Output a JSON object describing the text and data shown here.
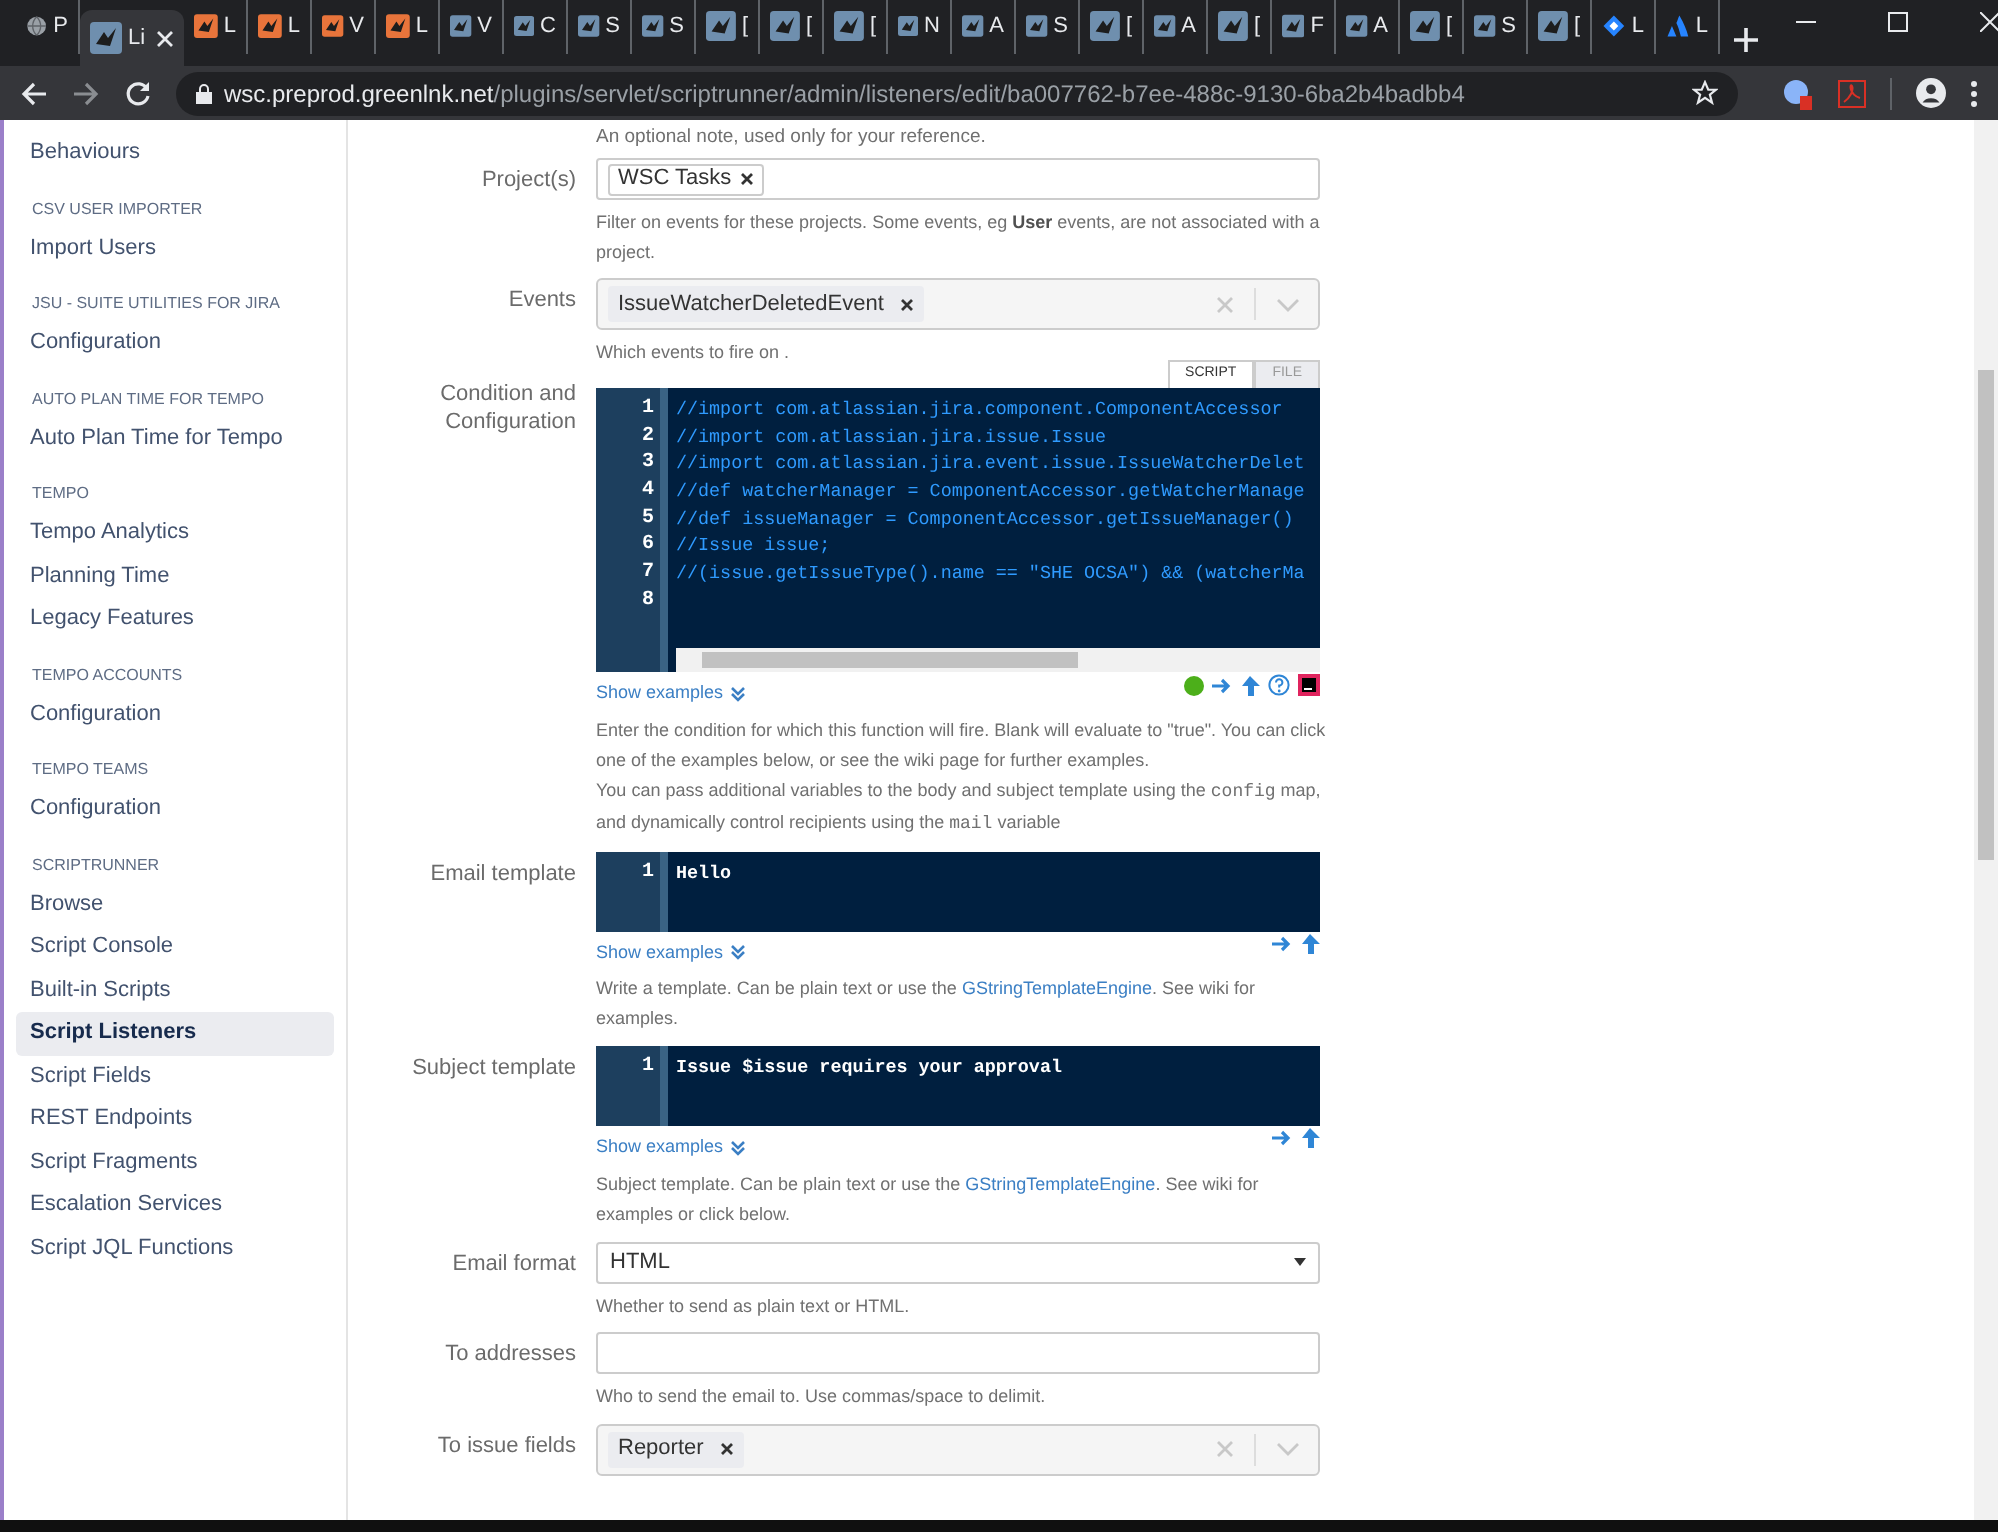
{
  "browser": {
    "tabs": [
      {
        "label": "P",
        "kind": "globe",
        "selected": false
      },
      {
        "label": "Li",
        "kind": "steel",
        "selected": true
      },
      {
        "label": "L",
        "kind": "orange",
        "selected": false
      },
      {
        "label": "L",
        "kind": "orange",
        "selected": false
      },
      {
        "label": "V",
        "kind": "orange",
        "selected": false
      },
      {
        "label": "L",
        "kind": "orange",
        "selected": false
      },
      {
        "label": "V",
        "kind": "steel",
        "selected": false
      },
      {
        "label": "C",
        "kind": "steel",
        "selected": false
      },
      {
        "label": "S",
        "kind": "steel",
        "selected": false
      },
      {
        "label": "S",
        "kind": "steel",
        "selected": false
      },
      {
        "label": "[",
        "kind": "steel",
        "selected": false
      },
      {
        "label": "[",
        "kind": "steel",
        "selected": false
      },
      {
        "label": "[",
        "kind": "steel",
        "selected": false
      },
      {
        "label": "N",
        "kind": "steel",
        "selected": false
      },
      {
        "label": "A",
        "kind": "steel",
        "selected": false
      },
      {
        "label": "S",
        "kind": "steel",
        "selected": false
      },
      {
        "label": "[",
        "kind": "steel",
        "selected": false
      },
      {
        "label": "A",
        "kind": "steel",
        "selected": false
      },
      {
        "label": "[",
        "kind": "steel",
        "selected": false
      },
      {
        "label": "F",
        "kind": "steel",
        "selected": false
      },
      {
        "label": "A",
        "kind": "steel",
        "selected": false
      },
      {
        "label": "[",
        "kind": "steel",
        "selected": false
      },
      {
        "label": "S",
        "kind": "steel",
        "selected": false
      },
      {
        "label": "[",
        "kind": "steel",
        "selected": false
      },
      {
        "label": "L",
        "kind": "diamond",
        "selected": false
      },
      {
        "label": "L",
        "kind": "atlassian",
        "selected": false
      }
    ],
    "url_host": "wsc.preprod.greenlnk.net",
    "url_path": "/plugins/servlet/scriptrunner/admin/listeners/edit/ba007762-b7ee-488c-9130-6ba2b4badbb4"
  },
  "sidebar": {
    "sections": [
      {
        "items": [
          {
            "label": "Behaviours",
            "selected": false
          }
        ]
      },
      {
        "heading": "CSV USER IMPORTER",
        "items": [
          {
            "label": "Import Users",
            "selected": false
          }
        ]
      },
      {
        "heading": "JSU - SUITE UTILITIES FOR JIRA",
        "items": [
          {
            "label": "Configuration",
            "selected": false
          }
        ]
      },
      {
        "heading": "AUTO PLAN TIME FOR TEMPO",
        "items": [
          {
            "label": "Auto Plan Time for Tempo",
            "selected": false
          }
        ]
      },
      {
        "heading": "TEMPO",
        "items": [
          {
            "label": "Tempo Analytics",
            "selected": false
          },
          {
            "label": "Planning Time",
            "selected": false
          },
          {
            "label": "Legacy Features",
            "selected": false
          }
        ]
      },
      {
        "heading": "TEMPO ACCOUNTS",
        "items": [
          {
            "label": "Configuration",
            "selected": false
          }
        ]
      },
      {
        "heading": "TEMPO TEAMS",
        "items": [
          {
            "label": "Configuration",
            "selected": false
          }
        ]
      },
      {
        "heading": "SCRIPTRUNNER",
        "items": [
          {
            "label": "Browse",
            "selected": false
          },
          {
            "label": "Script Console",
            "selected": false
          },
          {
            "label": "Built-in Scripts",
            "selected": false
          },
          {
            "label": "Script Listeners",
            "selected": true
          },
          {
            "label": "Script Fields",
            "selected": false
          },
          {
            "label": "REST Endpoints",
            "selected": false
          },
          {
            "label": "Script Fragments",
            "selected": false
          },
          {
            "label": "Escalation Services",
            "selected": false
          },
          {
            "label": "Script JQL Functions",
            "selected": false
          }
        ]
      }
    ]
  },
  "form": {
    "note": "An optional note, used only for your reference.",
    "fields": [
      {
        "kind": "tags",
        "label": "Project(s)",
        "tags": [
          "WSC Tasks"
        ],
        "help": [
          [
            {
              "kind": "plain",
              "text": "Filter on events for these projects. Some events, eg "
            },
            {
              "kind": "bold",
              "text": "User"
            },
            {
              "kind": "plain",
              "text": " events, are not associated with a project."
            }
          ]
        ]
      },
      {
        "kind": "select-tags",
        "label": "Events",
        "tags": [
          "IssueWatcherDeletedEvent"
        ],
        "help": [
          [
            {
              "kind": "plain",
              "text": "Which events to fire on ."
            }
          ]
        ]
      },
      {
        "kind": "script",
        "label": "Condition and Configuration",
        "modes": [
          {
            "label": "SCRIPT",
            "selected": true
          },
          {
            "label": "FILE",
            "selected": false
          }
        ],
        "lines": [
          {
            "number": "1",
            "text": "//import com.atlassian.jira.component.ComponentAccessor"
          },
          {
            "number": "2",
            "text": "//import com.atlassian.jira.issue.Issue"
          },
          {
            "number": "3",
            "text": "//import com.atlassian.jira.event.issue.IssueWatcherDelet"
          },
          {
            "number": "4",
            "text": "//def watcherManager = ComponentAccessor.getWatcherManage"
          },
          {
            "number": "5",
            "text": "//def issueManager = ComponentAccessor.getIssueManager()"
          },
          {
            "number": "6",
            "text": "//Issue issue;"
          },
          {
            "number": "7",
            "text": "//(issue.getIssueType().name == \"SHE OCSA\") && (watcherMa"
          },
          {
            "number": "8"
          }
        ],
        "examples_link": "Show examples",
        "help": [
          [
            {
              "kind": "plain",
              "text": "Enter the condition for which this function will fire. Blank will evaluate to \"true\". You can click one of the examples below, or see the wiki page for further examples."
            }
          ],
          [
            {
              "kind": "plain",
              "text": "You can pass additional variables to the body and subject template using the "
            },
            {
              "kind": "code",
              "text": "config"
            },
            {
              "kind": "plain",
              "text": " map, and dynamically control recipients using the "
            },
            {
              "kind": "code",
              "text": "mail"
            },
            {
              "kind": "plain",
              "text": " variable"
            }
          ]
        ]
      },
      {
        "kind": "code",
        "label": "Email template",
        "lines": [
          {
            "number": "1",
            "text": "Hello"
          }
        ],
        "examples_link": "Show examples",
        "help": [
          [
            {
              "kind": "plain",
              "text": "Write a template. Can be plain text or use the "
            },
            {
              "kind": "link",
              "text": "GStringTemplateEngine"
            },
            {
              "kind": "plain",
              "text": ". See wiki for examples."
            }
          ]
        ]
      },
      {
        "kind": "code",
        "label": "Subject template",
        "lines": [
          {
            "number": "1",
            "text": "Issue $issue requires your approval"
          }
        ],
        "examples_link": "Show examples",
        "help": [
          [
            {
              "kind": "plain",
              "text": "Subject template. Can be plain text or use the "
            },
            {
              "kind": "link",
              "text": "GStringTemplateEngine"
            },
            {
              "kind": "plain",
              "text": ". See wiki for examples or click below."
            }
          ]
        ]
      },
      {
        "kind": "select",
        "label": "Email format",
        "value": "HTML",
        "help": [
          [
            {
              "kind": "plain",
              "text": "Whether to send as plain text or HTML."
            }
          ]
        ]
      },
      {
        "kind": "text",
        "label": "To addresses",
        "help": [
          [
            {
              "kind": "plain",
              "text": "Who to send the email to. Use commas/space to delimit."
            }
          ]
        ]
      },
      {
        "kind": "select-tags",
        "label": "To issue fields",
        "tags": [
          "Reporter"
        ]
      }
    ]
  }
}
